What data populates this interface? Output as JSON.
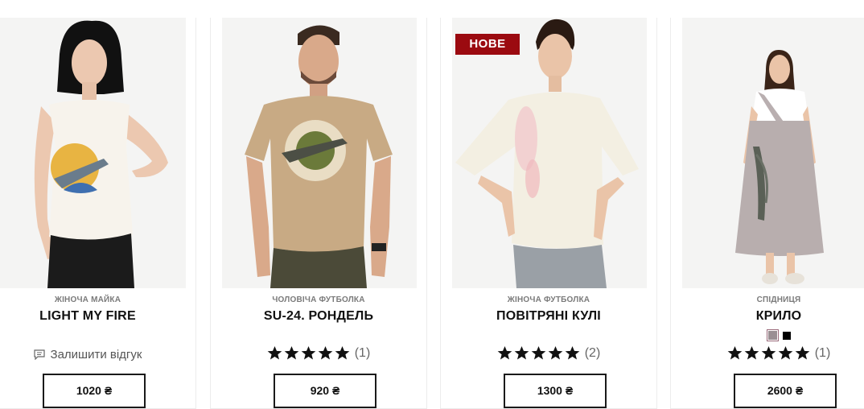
{
  "products": [
    {
      "category": "ЖІНОЧА МАЙКА",
      "title": "LIGHT MY FIRE",
      "review_label": "Залишити відгук",
      "price": "1020 ₴"
    },
    {
      "category": "ЧОЛОВІЧА ФУТБОЛКА",
      "title": "SU-24. РОНДЕЛЬ",
      "rating": 5,
      "rating_count": "(1)",
      "price": "920 ₴"
    },
    {
      "badge": "НОВЕ",
      "category": "ЖІНОЧА ФУТБОЛКА",
      "title": "ПОВІТРЯНІ КУЛІ",
      "rating": 5,
      "rating_count": "(2)",
      "price": "1300 ₴"
    },
    {
      "category": "СПІДНИЦЯ",
      "title": "КРИЛО",
      "swatches": [
        "#9a8f93",
        "#000000"
      ],
      "rating": 5,
      "rating_count": "(1)",
      "price": "2600 ₴"
    }
  ],
  "colors": {
    "badge": "#9b0a10",
    "star": "#111111",
    "button_border": "#1a1a1a"
  },
  "icons": [
    "comment-icon",
    "star-icon"
  ]
}
